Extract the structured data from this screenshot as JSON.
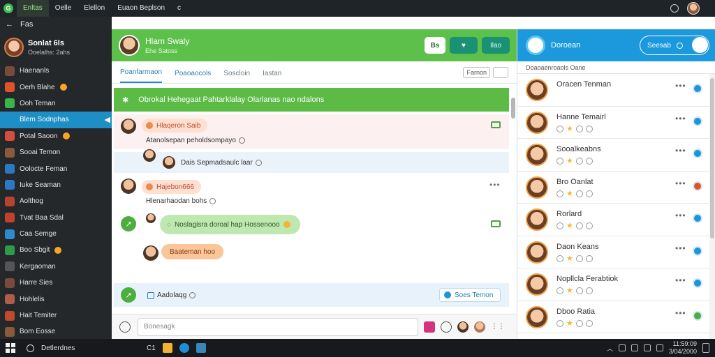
{
  "topbar": {
    "menu": [
      "Enltas",
      "Oelle",
      "Elellon",
      "Euaon Beplson"
    ],
    "menu_suffix": "c"
  },
  "sidebar": {
    "back_label": "Fas",
    "profile": {
      "name": "Sonlat 6ls",
      "sub": "Ooelalhs: 2ahs"
    },
    "items": [
      {
        "label": "Haenanls",
        "color": "#7a4b3a"
      },
      {
        "label": "Oerh Blahe",
        "color": "#e0532a"
      },
      {
        "label": "Ooh Teman",
        "color": "#3ab54a"
      },
      {
        "label": "Blem Sodnphas",
        "color": "#1d8fc6"
      },
      {
        "label": "Potal Saoon",
        "color": "#d94b3a"
      },
      {
        "label": "Sooai Temon",
        "color": "#8a5a3b"
      },
      {
        "label": "Oolocte Feman",
        "color": "#2b78c4"
      },
      {
        "label": "Iuke Seaman",
        "color": "#2b78c4"
      },
      {
        "label": "Aolthog",
        "color": "#b8432f"
      },
      {
        "label": "Tvat Baa Sdal",
        "color": "#c2412b"
      },
      {
        "label": "Caa Semge",
        "color": "#2b8ad0"
      },
      {
        "label": "Boo Sbgit",
        "color": "#2d9b4a"
      },
      {
        "label": "Kergaoman",
        "color": "#555"
      },
      {
        "label": "Harre Sies",
        "color": "#7a4b3a"
      },
      {
        "label": "Hohlelis",
        "color": "#b05c4a"
      },
      {
        "label": "Hait Temiter",
        "color": "#c04a2a"
      },
      {
        "label": "Bom Eosse",
        "color": "#8a5a3b"
      }
    ]
  },
  "chat": {
    "header": {
      "title": "Hlam Swaly",
      "sub": "Ehe Satoss"
    },
    "buttons": [
      "Bs",
      "",
      "Ilao"
    ],
    "tabs": [
      "Poanfarmaon",
      "Poaoaocols",
      "Soscloin",
      "Iastan"
    ],
    "tools": [
      "Farnon"
    ],
    "banner": "Obrokal Hehegaat Pahtarklalay  Olarlanas nao ndalons",
    "messages": [
      {
        "pill": "Hlaqeron Saib",
        "text": "Atanolsepan peholdsompayo"
      },
      {
        "text": "Dais Sepmadsaulc laar"
      },
      {
        "pill": "Hajebon666",
        "text": "Hlenarhaodan  bohs"
      },
      {
        "bubble": "Noslagisra doroal  hap  Hossenooo"
      },
      {
        "pill": "Baateman hoo"
      },
      {
        "text": "Aadolaqg",
        "button": "Soes Temon"
      }
    ],
    "composer_placeholder": "Bonesagk"
  },
  "contacts": {
    "title": "Doroean",
    "search": "Seesab",
    "subheader": "Doaoaenroaols Oane",
    "items": [
      {
        "name": "Oracen Tenman",
        "badge": "#1c96d8"
      },
      {
        "name": "Hanne Temairl",
        "badge": "#1c96d8"
      },
      {
        "name": "Sooalkeabns",
        "badge": "#1c96d8"
      },
      {
        "name": "Bro Oanlat",
        "badge": "#e0532a"
      },
      {
        "name": "Rorlard",
        "badge": "#1c96d8"
      },
      {
        "name": "Daon Keans",
        "badge": "#1c96d8"
      },
      {
        "name": "Nopllcla Ferabtiok",
        "badge": "#1c96d8"
      },
      {
        "name": "Dboo Ratia",
        "badge": "#4cae3e"
      }
    ]
  },
  "taskbar": {
    "search": "Detlerdnes",
    "item": "C1",
    "clock_time": "11:59:09",
    "clock_date": "3/04/2000"
  }
}
